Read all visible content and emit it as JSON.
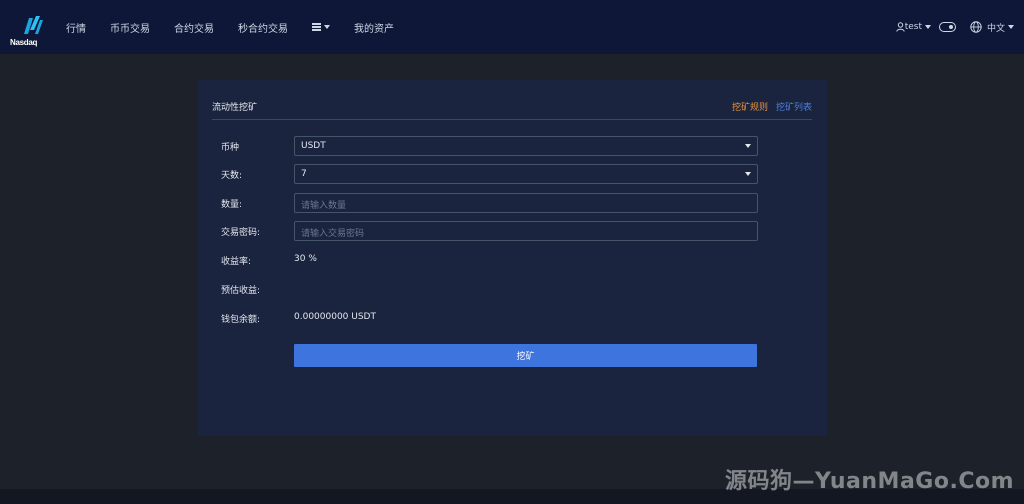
{
  "brand": {
    "logo_text": "Nasdaq"
  },
  "nav": {
    "items": [
      "行情",
      "币币交易",
      "合约交易",
      "秒合约交易"
    ],
    "more_label": "",
    "assets": "我的资产"
  },
  "header_right": {
    "user": "test",
    "language": "中文"
  },
  "card": {
    "title": "流动性挖矿",
    "link_rules": "挖矿规则",
    "link_list": "挖矿列表"
  },
  "form": {
    "currency": {
      "label": "币种",
      "value": "USDT"
    },
    "days": {
      "label": "天数:",
      "value": "7"
    },
    "amount": {
      "label": "数量:",
      "placeholder": "请输入数量"
    },
    "password": {
      "label": "交易密码:",
      "placeholder": "请输入交易密码"
    },
    "rate": {
      "label": "收益率:",
      "value": "30 %"
    },
    "estimated": {
      "label": "预估收益:",
      "value": ""
    },
    "balance": {
      "label": "钱包余额:",
      "value": "0.00000000 USDT"
    },
    "submit_label": "挖矿"
  },
  "watermark": "源码狗—YuanMaGo.Com",
  "colors": {
    "background": "#1d2129",
    "topbar": "#0e1737",
    "card": "#1b243f",
    "accent_blue": "#3d74de",
    "accent_orange": "#e8913b"
  }
}
